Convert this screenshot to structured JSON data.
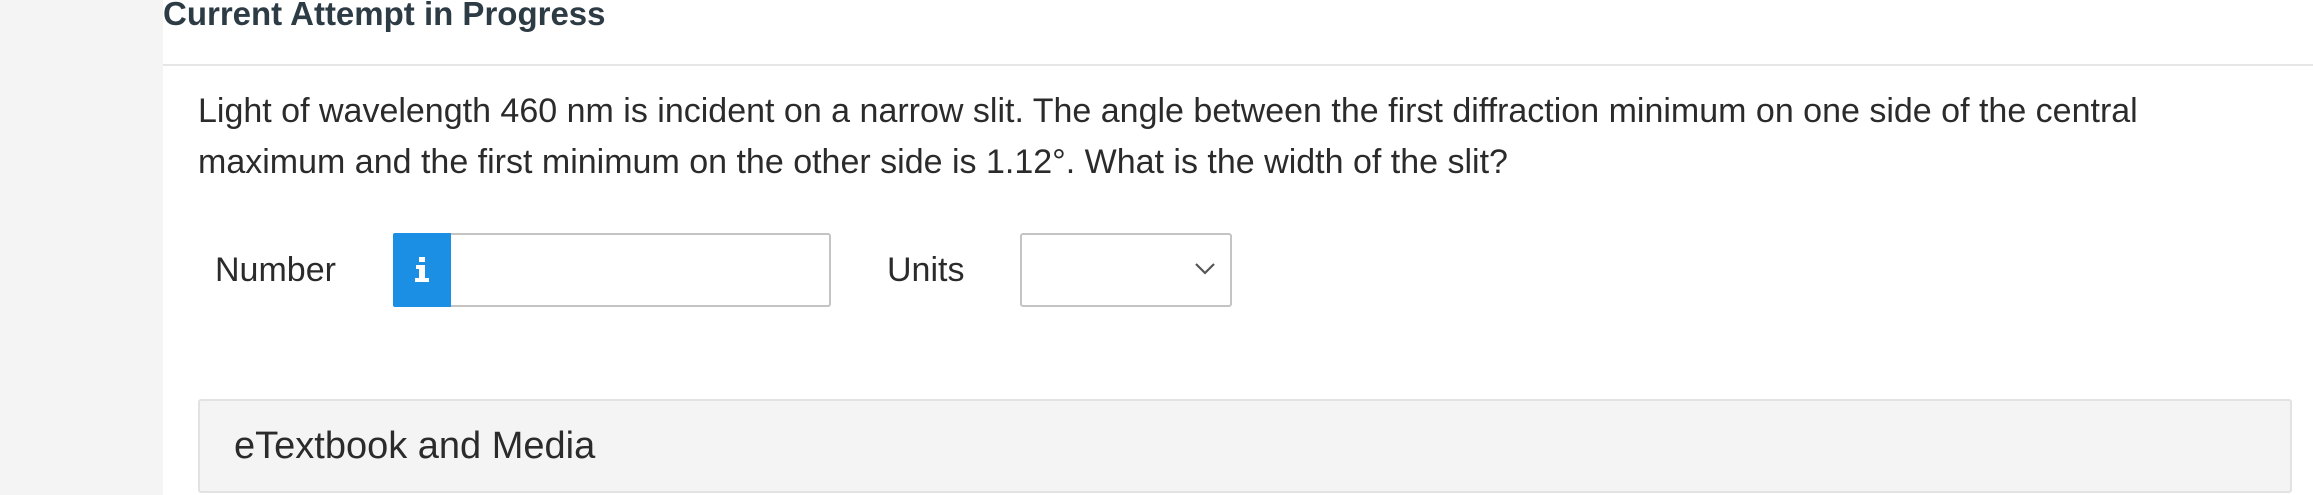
{
  "header": {
    "title": "Current Attempt in Progress"
  },
  "question": {
    "line1": "Light of wavelength 460 nm is incident on a narrow slit. The angle between the first diffraction minimum on one side of the central",
    "line2": "maximum and the first minimum on the other side is 1.12°. What is the width of the slit?"
  },
  "answer": {
    "number_label": "Number",
    "number_value": "",
    "info_icon": "info-icon",
    "units_label": "Units",
    "units_selected": ""
  },
  "resources": {
    "etextbook_label": "eTextbook and Media"
  },
  "colors": {
    "info_button": "#1a8fe3",
    "panel_background": "#f4f4f4",
    "gutter": "#f4f4f4"
  }
}
